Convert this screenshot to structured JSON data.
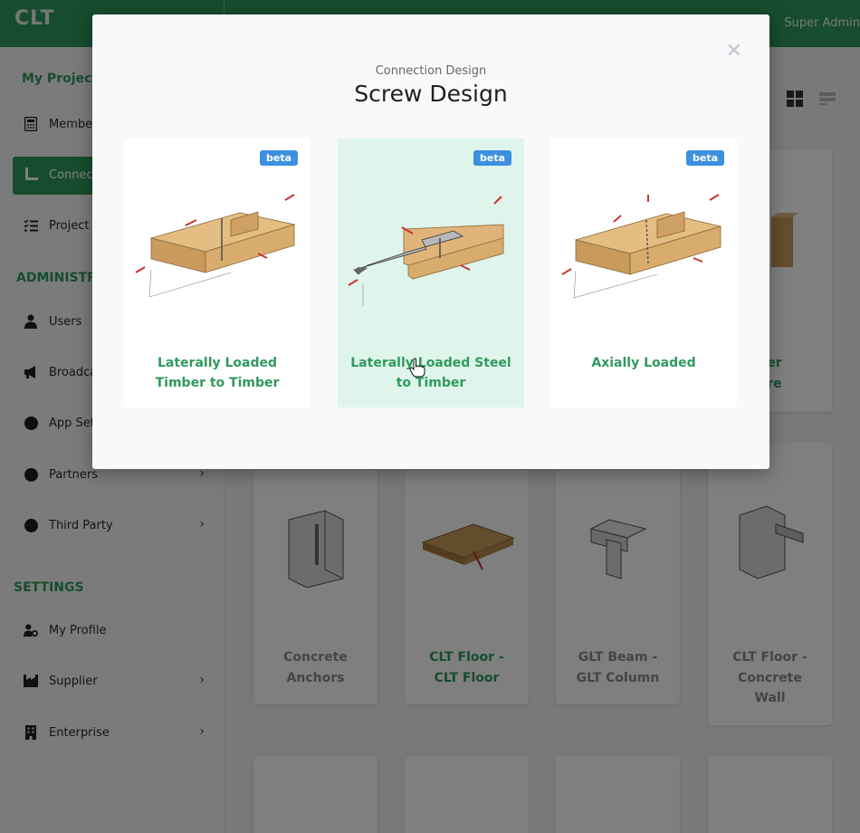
{
  "header": {
    "logo": "CLT",
    "user": "Super Admin"
  },
  "sidebar": {
    "heading_projects": "My Project",
    "items_projects": [
      {
        "label": "Member",
        "icon": "calculator-icon"
      },
      {
        "label": "Connec",
        "icon": "connection-icon",
        "active": true
      },
      {
        "label": "Project",
        "icon": "checklist-icon"
      }
    ],
    "heading_admin": "ADMINISTRA",
    "items_admin": [
      {
        "label": "Users",
        "icon": "user-icon"
      },
      {
        "label": "Broadca",
        "icon": "megaphone-icon"
      },
      {
        "label": "App Set",
        "icon": "dot-icon"
      },
      {
        "label": "Partners",
        "icon": "dot-icon"
      },
      {
        "label": "Third Party",
        "icon": "dot-icon"
      }
    ],
    "heading_settings": "SETTINGS",
    "items_settings": [
      {
        "label": "My Profile",
        "icon": "user-gear-icon"
      },
      {
        "label": "Supplier",
        "icon": "factory-icon"
      },
      {
        "label": "Enterprise",
        "icon": "building-icon"
      }
    ]
  },
  "background_cards": {
    "row1_partial_label": [
      "ber",
      "ure"
    ],
    "row2": [
      {
        "label": [
          "Concrete",
          "Anchors"
        ]
      },
      {
        "label": [
          "CLT Floor -",
          "CLT Floor"
        ]
      },
      {
        "label": [
          "GLT Beam -",
          "GLT Column"
        ]
      },
      {
        "label": [
          "CLT Floor -",
          "Concrete",
          "Wall"
        ]
      }
    ]
  },
  "modal": {
    "subtitle": "Connection Design",
    "title": "Screw Design",
    "close_icon": "close-icon",
    "options": [
      {
        "badge": "beta",
        "label": [
          "Laterally Loaded",
          "Timber to Timber"
        ]
      },
      {
        "badge": "beta",
        "label": [
          "Laterally Loaded Steel",
          "to Timber"
        ],
        "hover": true
      },
      {
        "badge": "beta",
        "label": [
          "Axially Loaded"
        ]
      }
    ]
  },
  "colors": {
    "brand": "#2f9a5d",
    "badge": "#3d8fe0",
    "hover_card": "#dff4ea",
    "overlay": "rgba(0,0,0,0.5)"
  }
}
